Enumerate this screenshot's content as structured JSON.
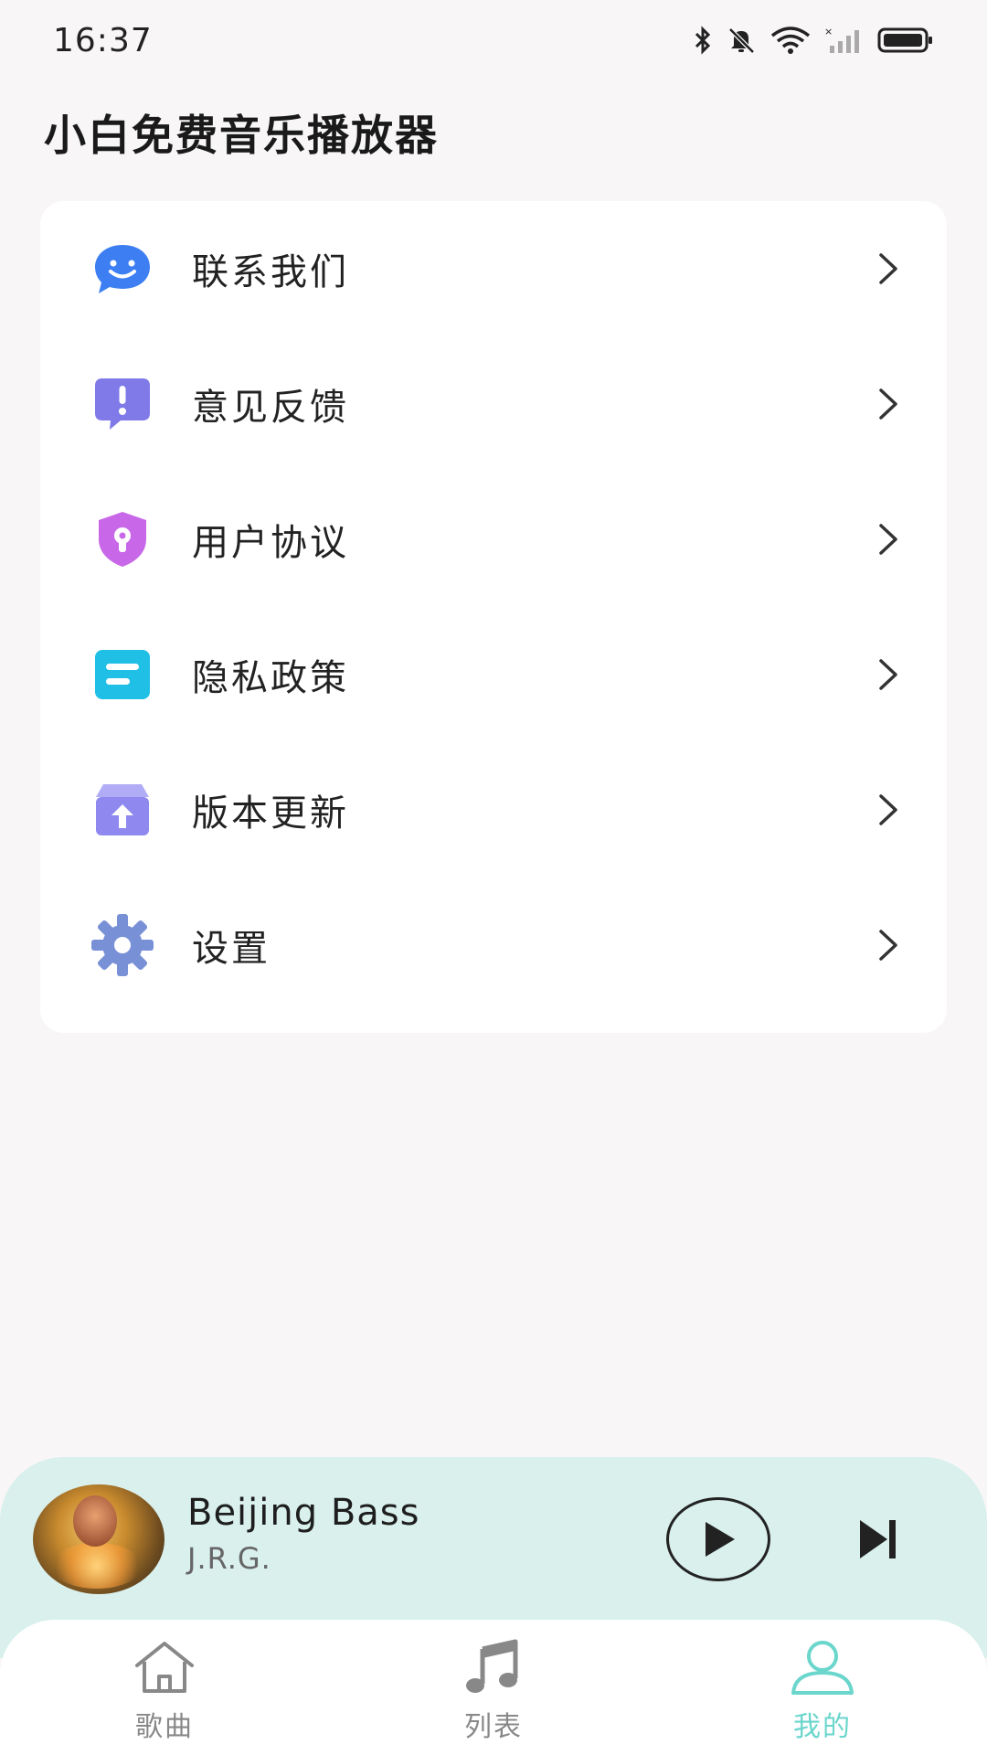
{
  "status_bar": {
    "time": "16:37",
    "icons": [
      "bluetooth-icon",
      "mute-icon",
      "wifi-icon",
      "signal-icon",
      "battery-icon"
    ]
  },
  "app": {
    "title": "小白免费音乐播放器"
  },
  "menu": {
    "items": [
      {
        "label": "联系我们",
        "icon": "chat-smile-icon",
        "color": "#3d7ff2"
      },
      {
        "label": "意见反馈",
        "icon": "feedback-exclaim-icon",
        "color": "#7f7ae8"
      },
      {
        "label": "用户协议",
        "icon": "shield-lock-icon",
        "color": "#c868e8"
      },
      {
        "label": "隐私政策",
        "icon": "document-lines-icon",
        "color": "#1fbfe6"
      },
      {
        "label": "版本更新",
        "icon": "update-box-icon",
        "color": "#8e88ef"
      },
      {
        "label": "设置",
        "icon": "gear-icon",
        "color": "#7890d6"
      }
    ]
  },
  "player": {
    "title": "Beijing Bass",
    "artist": "J.R.G.",
    "background_color": "#d9f0ec"
  },
  "bottom_nav": {
    "tabs": [
      {
        "label": "歌曲",
        "icon": "home-icon",
        "active": false
      },
      {
        "label": "列表",
        "icon": "music-note-icon",
        "active": false
      },
      {
        "label": "我的",
        "icon": "user-icon",
        "active": true
      }
    ],
    "active_color": "#6ad6cc",
    "inactive_color": "#888888"
  }
}
